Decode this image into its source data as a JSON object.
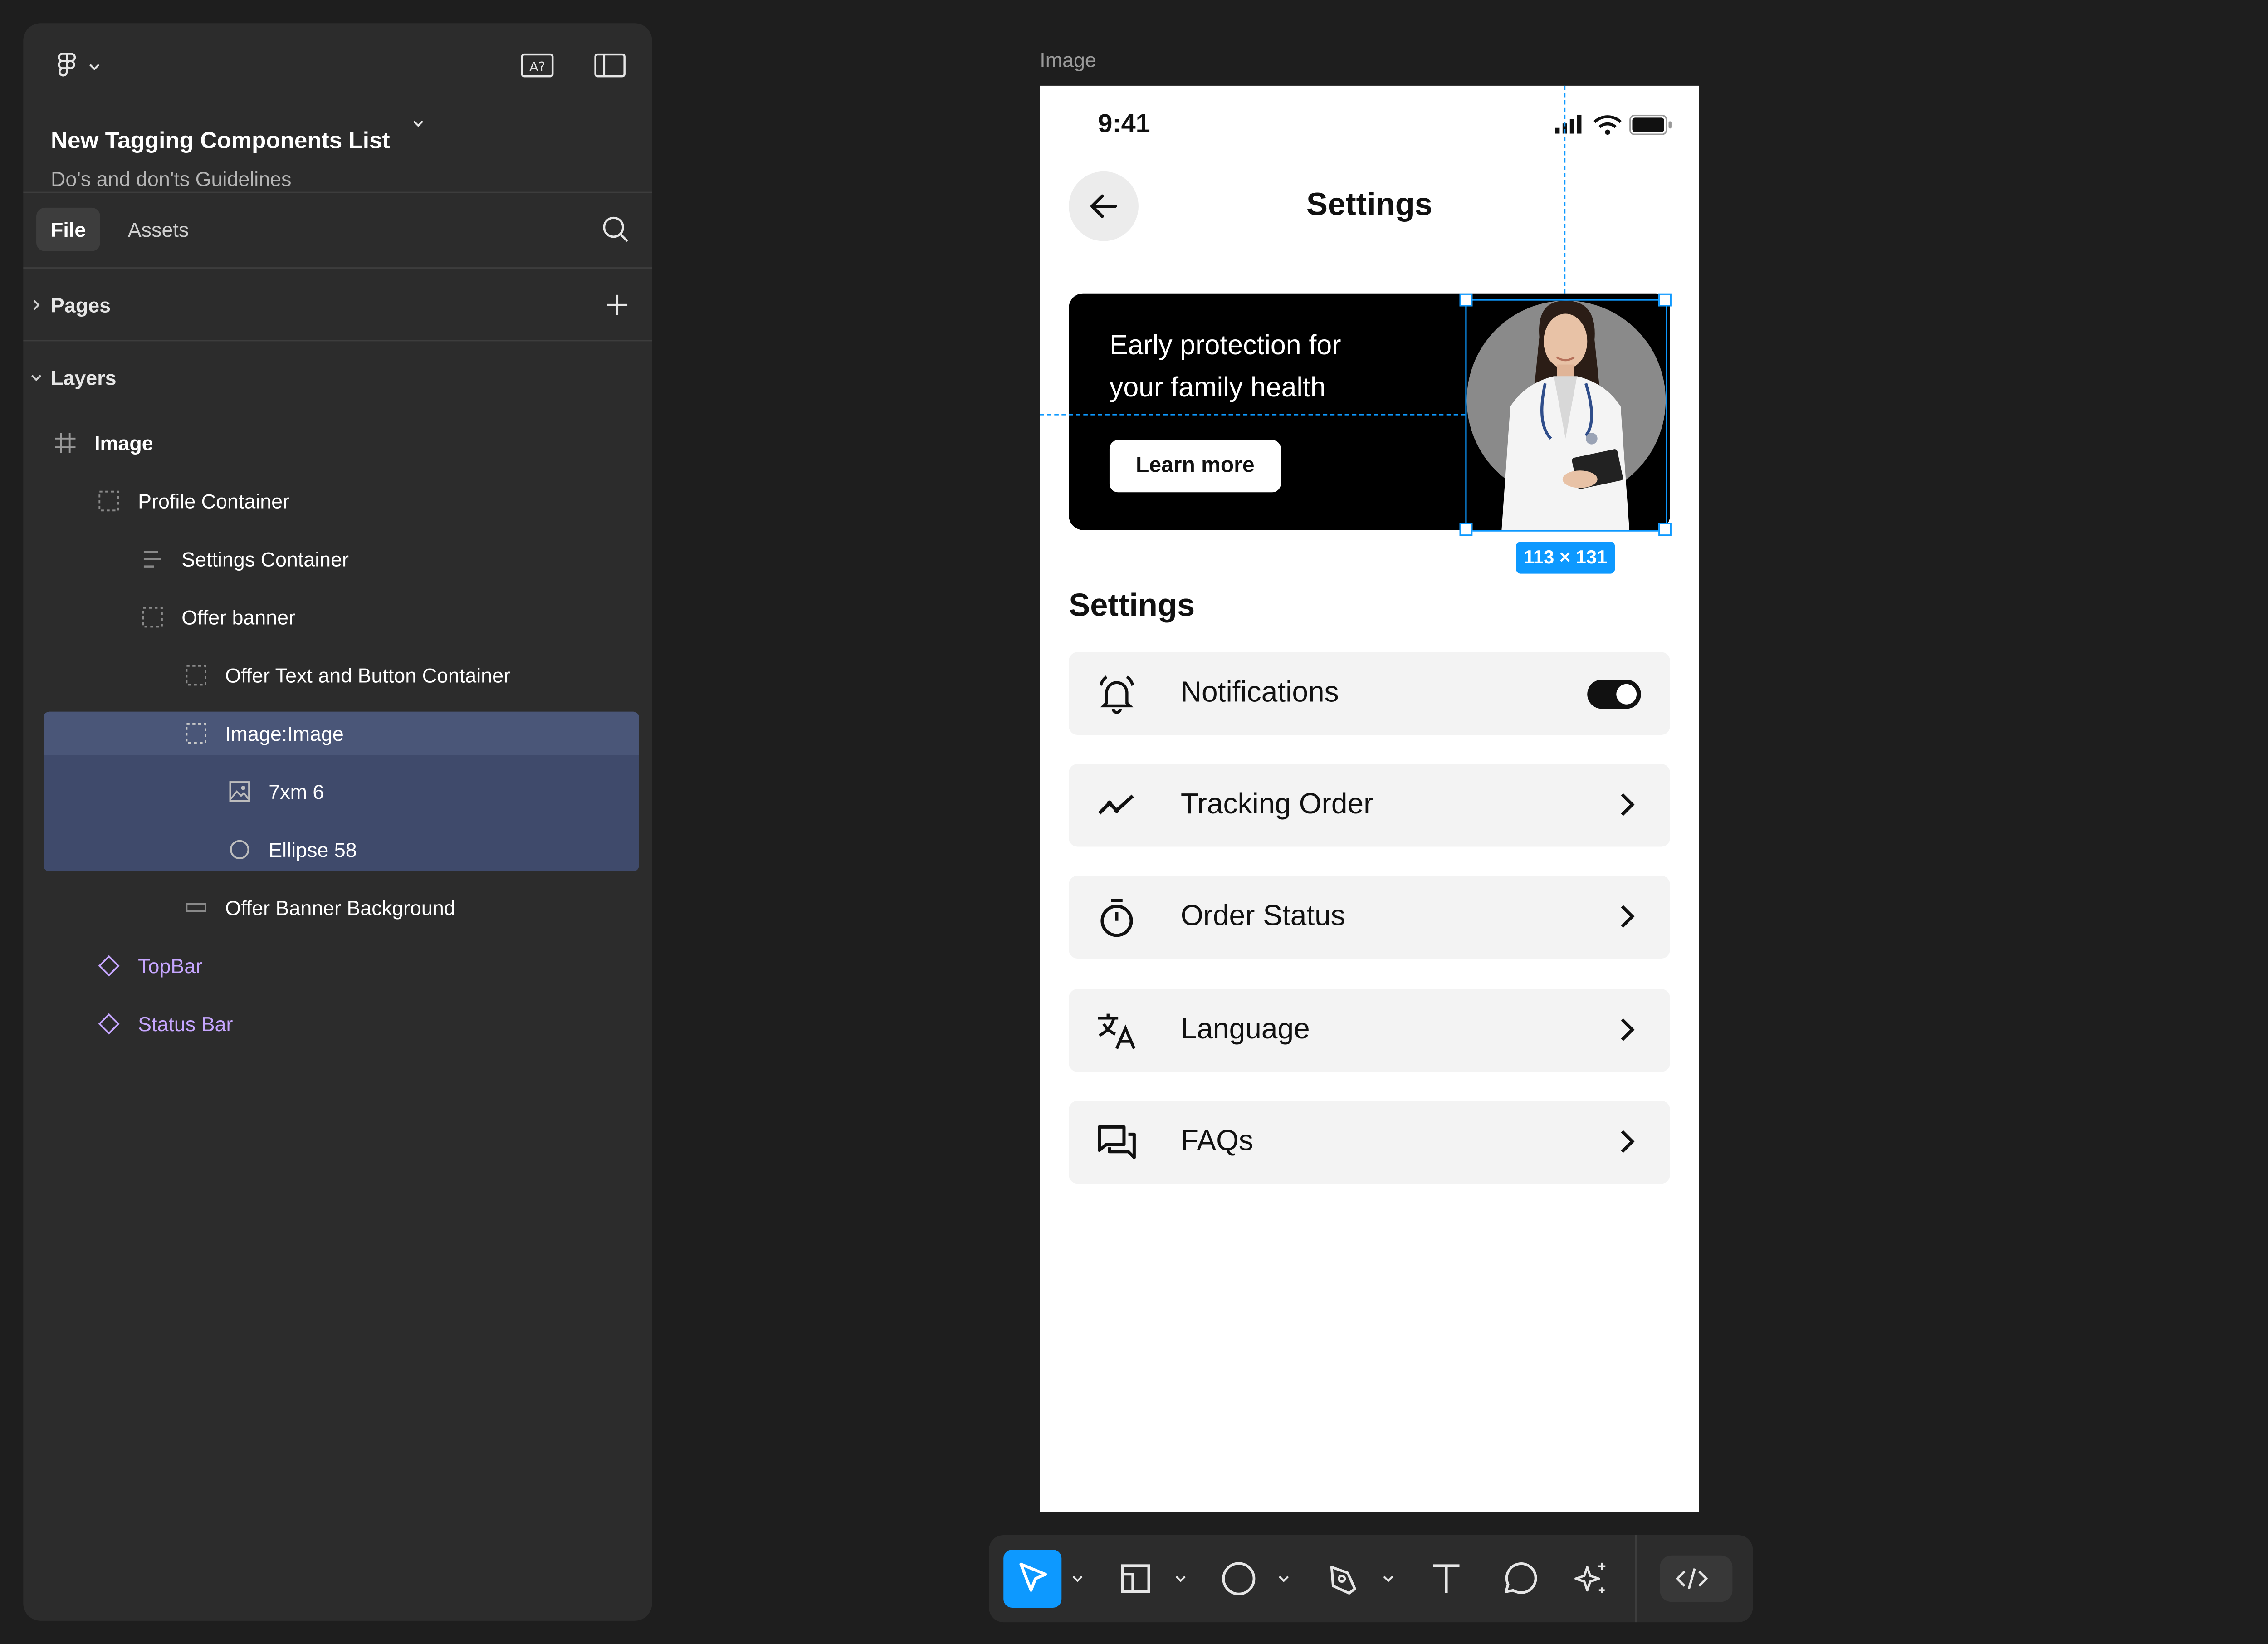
{
  "file": {
    "title": "New Tagging Components List",
    "subtitle": "Do's and don'ts Guidelines"
  },
  "tabs": {
    "file": "File",
    "assets": "Assets"
  },
  "sections": {
    "pages": "Pages",
    "layers": "Layers"
  },
  "layers": [
    {
      "label": "Image",
      "type": "frame"
    },
    {
      "label": "Profile Container",
      "type": "group"
    },
    {
      "label": "Settings Container",
      "type": "autolayout"
    },
    {
      "label": "Offer banner",
      "type": "group"
    },
    {
      "label": "Offer Text and Button Container",
      "type": "group"
    },
    {
      "label": "Image:Image",
      "type": "group",
      "selected": true
    },
    {
      "label": "7xm 6",
      "type": "image"
    },
    {
      "label": "Ellipse 58",
      "type": "ellipse"
    },
    {
      "label": "Offer Banner Background",
      "type": "rectangle"
    },
    {
      "label": "TopBar",
      "type": "component"
    },
    {
      "label": "Status Bar",
      "type": "component"
    }
  ],
  "canvas": {
    "frame_label": "Image",
    "selection_size": "113 × 131"
  },
  "phone": {
    "time": "9:41",
    "title": "Settings",
    "banner": {
      "text": "Early protection for your family health",
      "button": "Learn more"
    },
    "section_title": "Settings",
    "rows": [
      {
        "label": "Notifications",
        "icon": "bell-icon",
        "control": "toggle",
        "toggle_on": true
      },
      {
        "label": "Tracking Order",
        "icon": "trend-icon",
        "control": "chevron"
      },
      {
        "label": "Order Status",
        "icon": "timer-icon",
        "control": "chevron"
      },
      {
        "label": "Language",
        "icon": "translate-icon",
        "control": "chevron"
      },
      {
        "label": "FAQs",
        "icon": "chat-icon",
        "control": "chevron"
      }
    ]
  },
  "toolbar": {
    "tools": [
      "move-tool",
      "frame-tool",
      "shape-tool",
      "pen-tool",
      "text-tool",
      "comment-tool",
      "actions-tool",
      "dev-mode-toggle"
    ]
  },
  "colors": {
    "accent": "#0d99ff",
    "panel_bg": "#2c2c2c",
    "canvas_bg": "#1e1e1e",
    "component": "#c6a6ff",
    "selection_row": "#3f4a6b"
  }
}
